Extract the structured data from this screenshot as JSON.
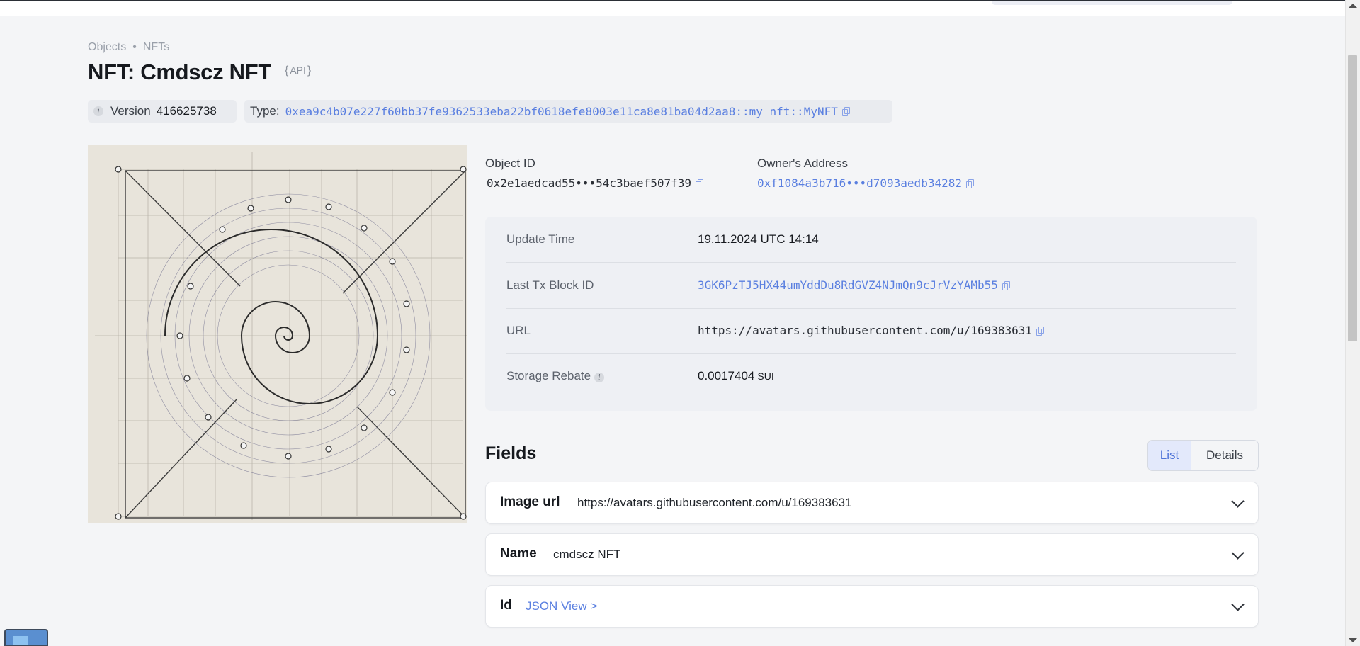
{
  "breadcrumb": {
    "items": [
      "Objects",
      "NFTs"
    ],
    "separator": "•"
  },
  "title": "NFT: Cmdscz NFT",
  "api_label": "API",
  "version": {
    "label": "Version",
    "value": "416625738"
  },
  "type": {
    "label": "Type:",
    "value": "0xea9c4b07e227f60bb37fe9362533eba22bf0618efe8003e11ca8e81ba04d2aa8::my_nft::MyNFT"
  },
  "object": {
    "object_id_label": "Object ID",
    "object_id": "0x2e1aedcad55•••54c3baef507f39",
    "owner_label": "Owner's Address",
    "owner": "0xf1084a3b716•••d7093aedb34282"
  },
  "properties": {
    "update_time_label": "Update Time",
    "update_time": "19.11.2024 UTC 14:14",
    "last_tx_label": "Last Tx Block ID",
    "last_tx": "3GK6PzTJ5HX44umYddDu8RdGVZ4NJmQn9cJrVzYAMb55",
    "url_label": "URL",
    "url": "https://avatars.githubusercontent.com/u/169383631",
    "storage_rebate_label": "Storage Rebate",
    "storage_rebate": "0.0017404",
    "storage_rebate_unit": "SUI"
  },
  "fields": {
    "title": "Fields",
    "view_list": "List",
    "view_details": "Details",
    "items": [
      {
        "name": "Image url",
        "value": "https://avatars.githubusercontent.com/u/169383631"
      },
      {
        "name": "Name",
        "value": "cmdscz NFT"
      },
      {
        "name": "Id",
        "value": "JSON View >"
      }
    ]
  },
  "colors": {
    "link": "#5a7fe0",
    "background": "#f4f5f7",
    "card": "#eef0f4"
  }
}
